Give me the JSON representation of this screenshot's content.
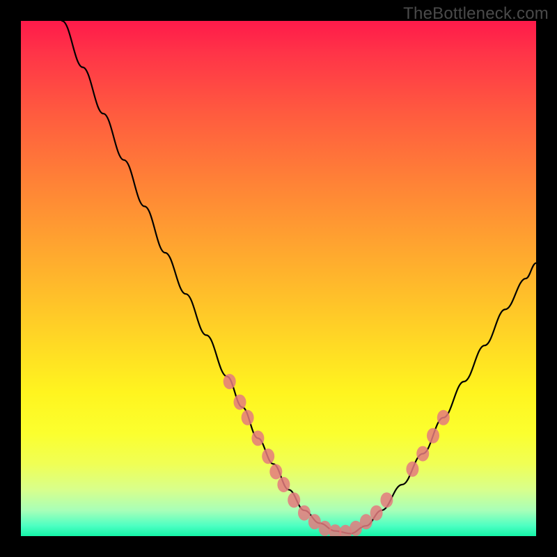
{
  "watermark": "TheBottleneck.com",
  "chart_data": {
    "type": "line",
    "title": "",
    "xlabel": "",
    "ylabel": "",
    "xlim": [
      0,
      100
    ],
    "ylim": [
      0,
      100
    ],
    "series": [
      {
        "name": "curve",
        "x": [
          8,
          12,
          16,
          20,
          24,
          28,
          32,
          36,
          40,
          43,
          46,
          49,
          52,
          55,
          58,
          61,
          64,
          67,
          70,
          74,
          78,
          82,
          86,
          90,
          94,
          98,
          100
        ],
        "y": [
          100,
          91,
          82,
          73,
          64,
          55,
          47,
          39,
          31,
          25,
          19,
          14,
          9,
          5,
          2.5,
          1,
          0.5,
          2,
          5,
          10,
          16,
          23,
          30,
          37,
          44,
          50,
          53
        ]
      }
    ],
    "markers": [
      {
        "x": 40.5,
        "y": 30
      },
      {
        "x": 42.5,
        "y": 26
      },
      {
        "x": 44,
        "y": 23
      },
      {
        "x": 46,
        "y": 19
      },
      {
        "x": 48,
        "y": 15.5
      },
      {
        "x": 49.5,
        "y": 12.5
      },
      {
        "x": 51,
        "y": 10
      },
      {
        "x": 53,
        "y": 7
      },
      {
        "x": 55,
        "y": 4.5
      },
      {
        "x": 57,
        "y": 2.8
      },
      {
        "x": 59,
        "y": 1.5
      },
      {
        "x": 61,
        "y": 0.8
      },
      {
        "x": 63,
        "y": 0.7
      },
      {
        "x": 65,
        "y": 1.5
      },
      {
        "x": 67,
        "y": 2.8
      },
      {
        "x": 69,
        "y": 4.5
      },
      {
        "x": 71,
        "y": 7
      },
      {
        "x": 76,
        "y": 13
      },
      {
        "x": 78,
        "y": 16
      },
      {
        "x": 80,
        "y": 19.5
      },
      {
        "x": 82,
        "y": 23
      }
    ],
    "gradient_stops": [
      {
        "pos": 0,
        "color": "#ff1a4a"
      },
      {
        "pos": 50,
        "color": "#ffc026"
      },
      {
        "pos": 80,
        "color": "#fff41f"
      },
      {
        "pos": 100,
        "color": "#15f5a8"
      }
    ]
  }
}
